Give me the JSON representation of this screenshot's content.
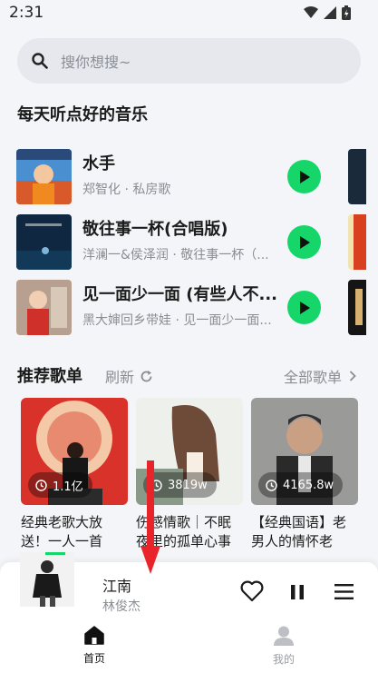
{
  "status": {
    "time": "2:31"
  },
  "search": {
    "placeholder": "搜你想搜~"
  },
  "daily": {
    "title": "每天听点好的音乐",
    "songs": [
      {
        "title": "水手",
        "subtitle": "郑智化 · 私房歌"
      },
      {
        "title": "敬往事一杯(合唱版)",
        "subtitle": "洋澜一&侯泽润 · 敬往事一杯（..."
      },
      {
        "title": "见一面少一面 (有些人不...",
        "subtitle": "黑大婶回乡带娃 · 见一面少一面..."
      }
    ]
  },
  "playlists": {
    "title": "推荐歌单",
    "refresh_label": "刷新",
    "all_label": "全部歌单",
    "items": [
      {
        "count": "1.1亿",
        "name": "经典老歌大放送！一人一首代..."
      },
      {
        "count": "3819w",
        "name": "伤感情歌｜不眠夜里的孤单心事"
      },
      {
        "count": "4165.8w",
        "name": "【经典国语】老男人的情怀老男..."
      }
    ]
  },
  "player": {
    "title": "江南",
    "artist": "林俊杰"
  },
  "tabs": [
    {
      "label": "首页",
      "active": true
    },
    {
      "label": "我的",
      "active": false
    }
  ],
  "colors": {
    "accent": "#16d66a",
    "background": "#f4f5f8",
    "annotation_arrow": "#e8232a"
  }
}
